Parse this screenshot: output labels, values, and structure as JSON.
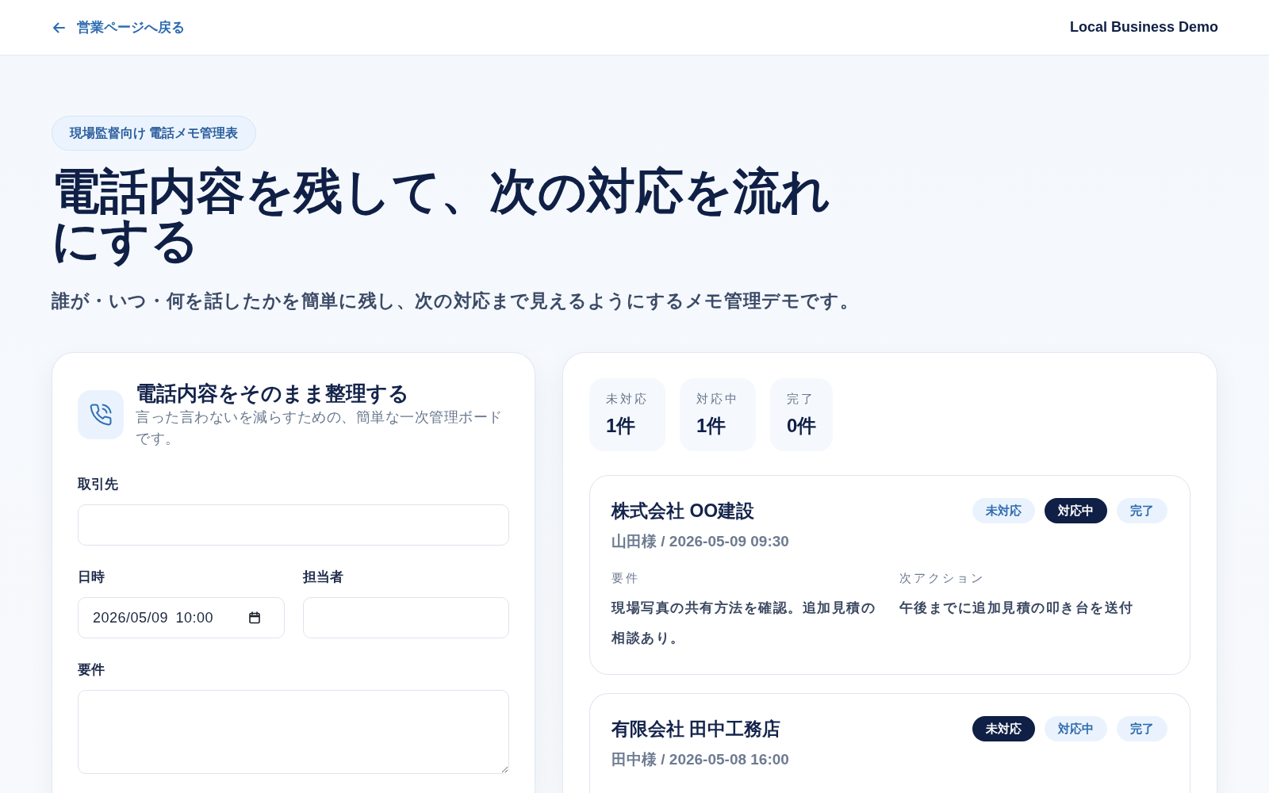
{
  "header": {
    "back_link": "営業ページへ戻る",
    "brand": "Local Business Demo"
  },
  "hero": {
    "tag": "現場監督向け 電話メモ管理表",
    "title": "電話内容を残して、次の対応を流れにする",
    "subtitle": "誰が・いつ・何を話したかを簡単に残し、次の対応まで見えるようにするメモ管理デモです。"
  },
  "form_panel": {
    "title": "電話内容をそのまま整理する",
    "description": "言った言わないを減らすための、簡単な一次管理ボードです。",
    "rows": [
      [
        {
          "label": "取引先",
          "kind": "text"
        }
      ],
      [
        {
          "label": "日時",
          "kind": "datetime",
          "value": "2026/05/09 10:00"
        },
        {
          "label": "担当者",
          "kind": "text"
        }
      ],
      [
        {
          "label": "要件",
          "kind": "textarea"
        }
      ]
    ]
  },
  "board": {
    "stats": [
      {
        "label": "未対応",
        "value": "1件"
      },
      {
        "label": "対応中",
        "value": "1件"
      },
      {
        "label": "完了",
        "value": "0件"
      }
    ],
    "records": [
      {
        "company": "株式会社 OO建設",
        "meta": "山田様 / 2026-05-09 09:30",
        "statuses": [
          {
            "label": "未対応",
            "selected": false
          },
          {
            "label": "対応中",
            "selected": true
          },
          {
            "label": "完了",
            "selected": false
          }
        ],
        "details": [
          {
            "label": "要件",
            "text": "現場写真の共有方法を確認。追加見積の相談あり。"
          },
          {
            "label": "次アクション",
            "text": "午後までに追加見積の叩き台を送付"
          }
        ]
      },
      {
        "company": "有限会社 田中工務店",
        "meta": "田中様 / 2026-05-08 16:00",
        "statuses": [
          {
            "label": "未対応",
            "selected": true
          },
          {
            "label": "対応中",
            "selected": false
          },
          {
            "label": "完了",
            "selected": false
          }
        ]
      }
    ]
  }
}
